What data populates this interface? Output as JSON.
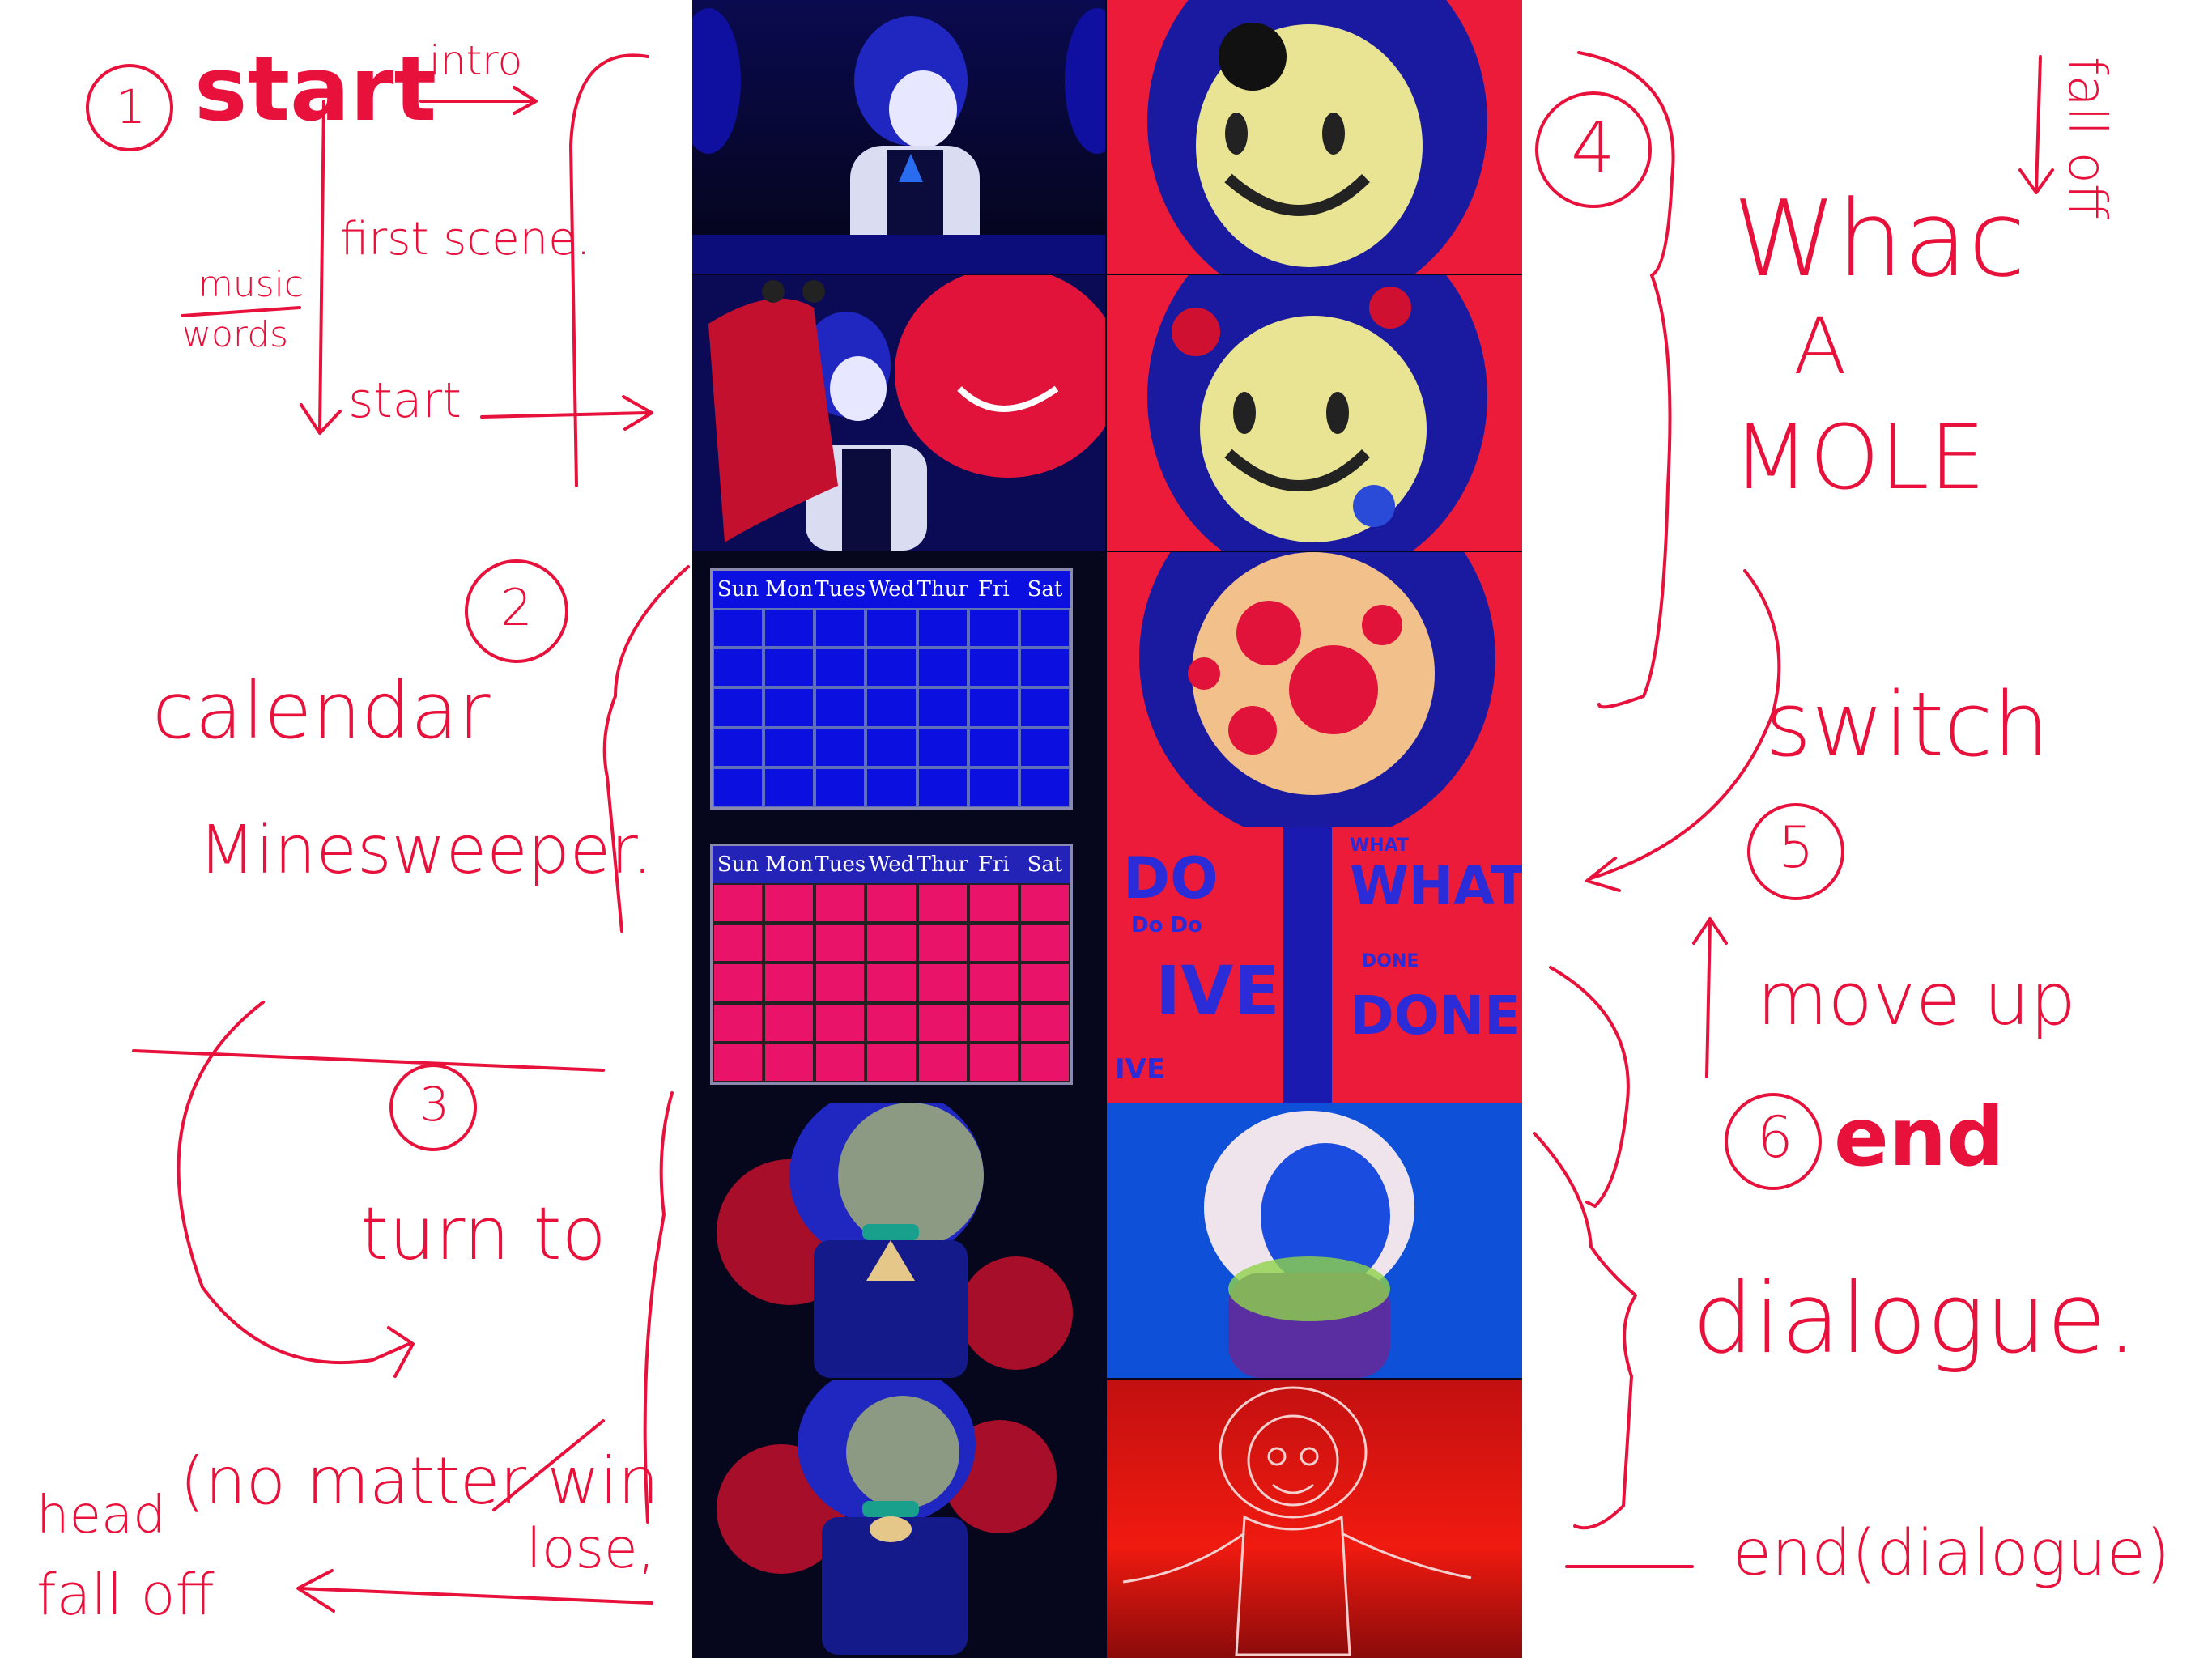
{
  "colors": {
    "ink": "#e8113b",
    "storyboard_bg": "#06071c",
    "red": "#ed1b3a",
    "blue": "#1212c8"
  },
  "notes": {
    "step1_number": "1",
    "step1_label": "start",
    "intro": "intro",
    "first_scene": "first scene.",
    "music": "music",
    "words": "words",
    "start_arrow": "start",
    "step2_number": "2",
    "calendar": "calendar",
    "minesweeper": "Minesweeper.",
    "step3_number": "3",
    "turn_to": "turn to",
    "no_matter": "(no matter win",
    "lose": "lose,",
    "head": "head",
    "fall_off": "fall off",
    "step4_number": "4",
    "fall_off_top": "fall off",
    "whac": "Whac",
    "a": "A",
    "mole": "MOLE",
    "switch": "switch",
    "step5_number": "5",
    "move_up": "move up",
    "step6_number": "6",
    "end": "end",
    "dialogue": "dialogue.",
    "end_dialogue": "end(dialogue)"
  },
  "calendar": {
    "days": [
      "Sun",
      "Mon",
      "Tues",
      "Wed",
      "Thur",
      "Fri",
      "Sat"
    ]
  },
  "panel_text": {
    "do": "DO",
    "do_small": "Do Do",
    "ive": "IVE",
    "ive_small": "IVE",
    "what": "WHAT",
    "what_small": "WHAT",
    "done": "DONE",
    "done_small": "DONE"
  }
}
